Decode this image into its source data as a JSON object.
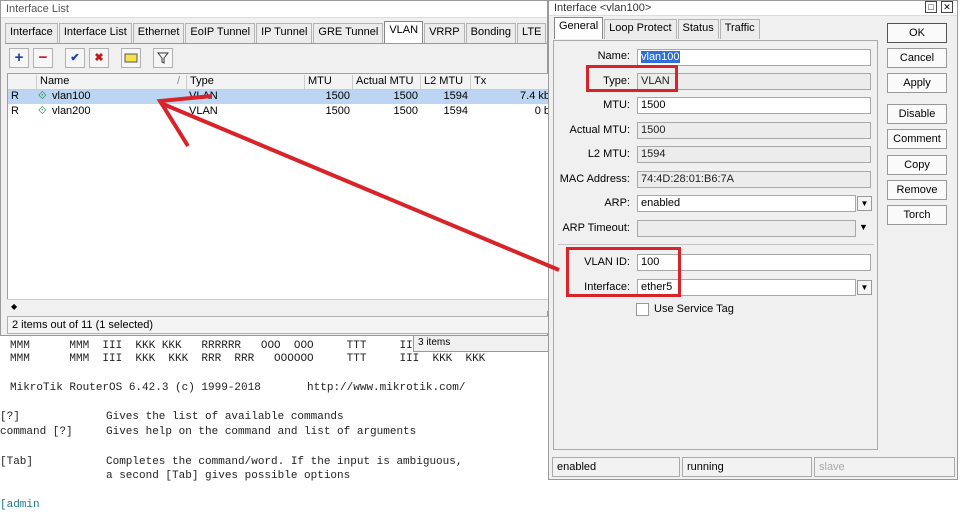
{
  "terminal": {
    "banner1": "MMM      MMM  III  KKK KKK   RRRRRR   OOO  OOO     TTT     III  KKK  KKK",
    "banner2": "MMM      MMM  III  KKK  KKK  RRR  RRR   OOOOOO     TTT     III  KKK  KKK",
    "version_line": "MikroTik RouterOS 6.42.3 (c) 1999-2018       http://www.mikrotik.com/",
    "help1_key": "[?]",
    "help1_text": "Gives the list of available commands",
    "help2_key": "command [?]",
    "help2_text": "Gives help on the command and list of arguments",
    "help3_key": "[Tab]",
    "help3_text1": "Completes the command/word. If the input is ambiguous,",
    "help3_text2": "a second [Tab] gives possible options",
    "prompt": "[admin"
  },
  "interface_list": {
    "title": "Interface List",
    "tabs": [
      "Interface",
      "Interface List",
      "Ethernet",
      "EoIP Tunnel",
      "IP Tunnel",
      "GRE Tunnel",
      "VLAN",
      "VRRP",
      "Bonding",
      "LTE"
    ],
    "active_tab": "VLAN",
    "columns": [
      "Name",
      "Type",
      "MTU",
      "Actual MTU",
      "L2 MTU",
      "Tx"
    ],
    "rows": [
      {
        "flag": "R",
        "name": "vlan100",
        "type": "VLAN",
        "mtu": "1500",
        "actual_mtu": "1500",
        "l2_mtu": "1594",
        "tx": "7.4 kb"
      },
      {
        "flag": "R",
        "name": "vlan200",
        "type": "VLAN",
        "mtu": "1500",
        "actual_mtu": "1500",
        "l2_mtu": "1594",
        "tx": "0 b"
      }
    ],
    "status": "2 items out of 11 (1 selected)",
    "behind_status": "3 items"
  },
  "dialog": {
    "title": "Interface <vlan100>",
    "tabs": [
      "General",
      "Loop Protect",
      "Status",
      "Traffic"
    ],
    "active_tab": "General",
    "fields": {
      "name_label": "Name:",
      "name_value": "vlan100",
      "type_label": "Type:",
      "type_value": "VLAN",
      "mtu_label": "MTU:",
      "mtu_value": "1500",
      "actual_mtu_label": "Actual MTU:",
      "actual_mtu_value": "1500",
      "l2_mtu_label": "L2 MTU:",
      "l2_mtu_value": "1594",
      "mac_label": "MAC Address:",
      "mac_value": "74:4D:28:01:B6:7A",
      "arp_label": "ARP:",
      "arp_value": "enabled",
      "arp_timeout_label": "ARP Timeout:",
      "arp_timeout_value": "",
      "vlan_id_label": "VLAN ID:",
      "vlan_id_value": "100",
      "interface_label": "Interface:",
      "interface_value": "ether5",
      "service_tag_label": "Use Service Tag"
    },
    "buttons": {
      "ok": "OK",
      "cancel": "Cancel",
      "apply": "Apply",
      "disable": "Disable",
      "comment": "Comment",
      "copy": "Copy",
      "remove": "Remove",
      "torch": "Torch"
    },
    "status": {
      "state": "enabled",
      "run": "running",
      "slave": "slave"
    }
  },
  "colors": {
    "highlight": "#d8232a",
    "selection": "#bcd5f2"
  }
}
